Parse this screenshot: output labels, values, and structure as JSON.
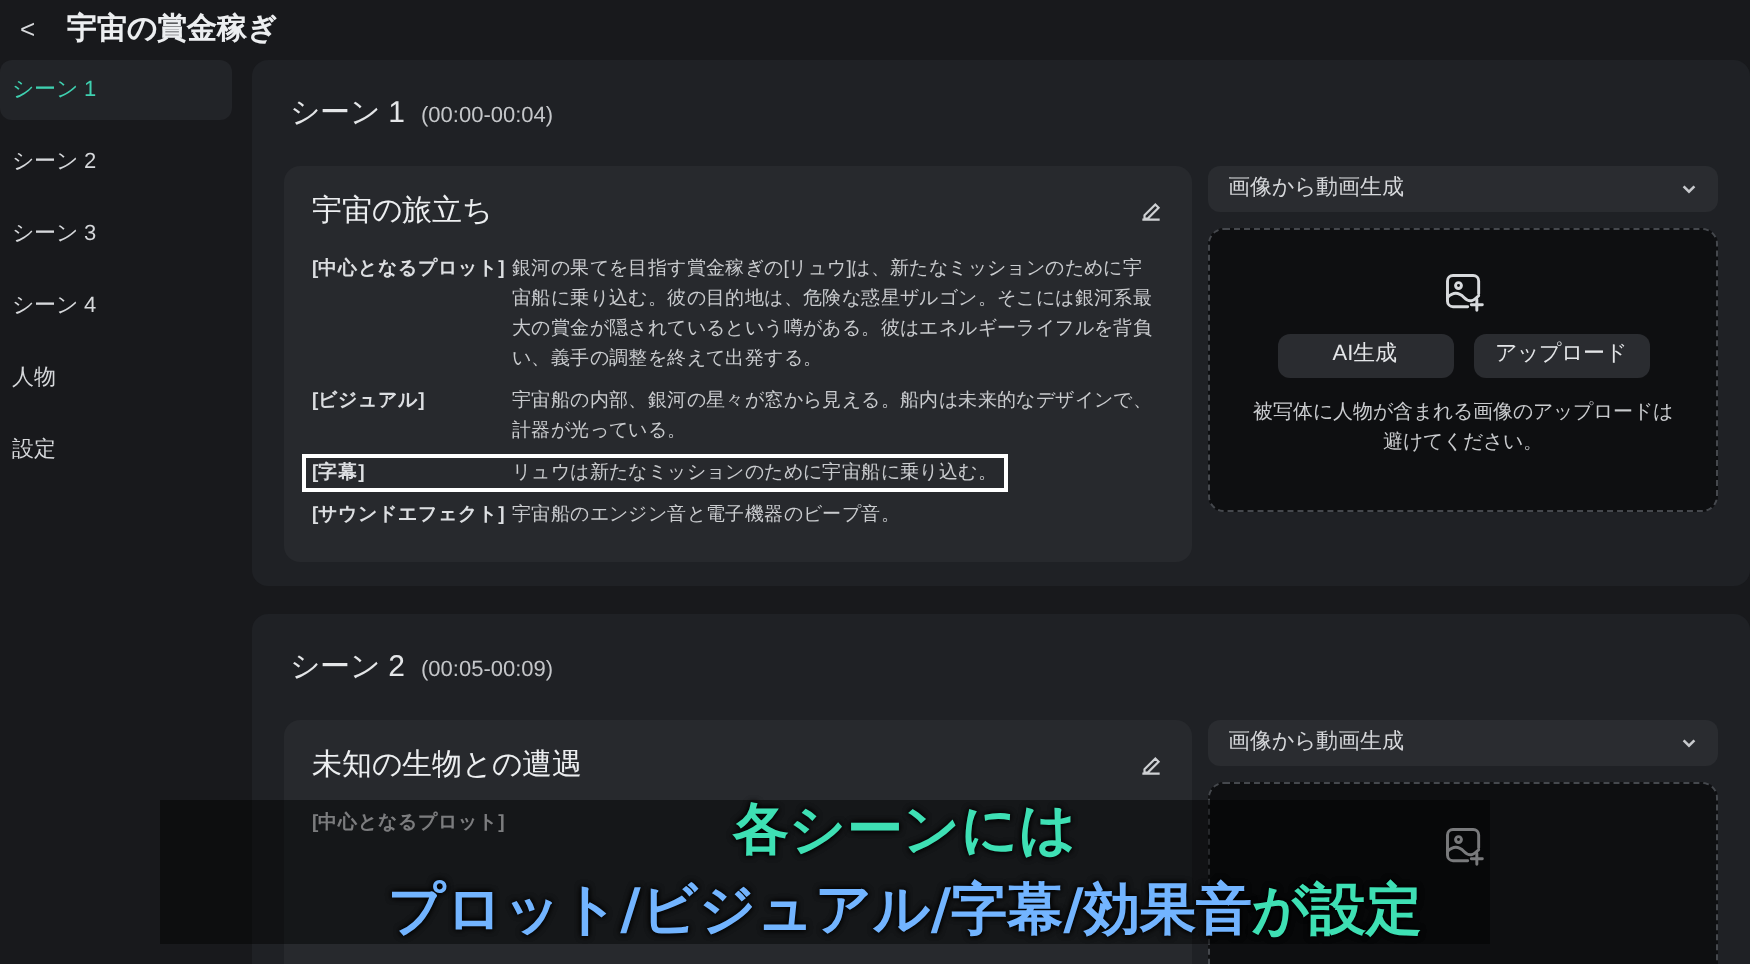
{
  "header": {
    "back": "<",
    "title": "宇宙の賞金稼ぎ"
  },
  "sidebar": {
    "items": [
      {
        "label": "シーン 1",
        "selected": true
      },
      {
        "label": "シーン 2",
        "selected": false
      },
      {
        "label": "シーン 3",
        "selected": false
      },
      {
        "label": "シーン 4",
        "selected": false
      },
      {
        "label": "人物",
        "selected": false
      },
      {
        "label": "設定",
        "selected": false
      }
    ]
  },
  "scenes": [
    {
      "name": "シーン 1",
      "time": "(00:00-00:04)",
      "title": "宇宙の旅立ち",
      "rows": [
        {
          "label": "[中心となるプロット]",
          "text": "銀河の果てを目指す賞金稼ぎの[リュウ]は、新たなミッションのために宇宙船に乗り込む。彼の目的地は、危険な惑星ザルゴン。そこには銀河系最大の賞金が隠されているという噂がある。彼はエネルギーライフルを背負い、義手の調整を終えて出発する。",
          "highlighted": false
        },
        {
          "label": "[ビジュアル]",
          "text": "宇宙船の内部、銀河の星々が窓から見える。船内は未来的なデザインで、計器が光っている。",
          "highlighted": false
        },
        {
          "label": "[字幕]",
          "text": "リュウは新たなミッションのために宇宙船に乗り込む。",
          "highlighted": true
        },
        {
          "label": "[サウンドエフェクト]",
          "text": "宇宙船のエンジン音と電子機器のビープ音。",
          "highlighted": false
        }
      ],
      "media": {
        "mode": "画像から動画生成",
        "buttons": [
          "AI生成",
          "アップロード"
        ],
        "note": "被写体に人物が含まれる画像のアップロードは避けてください。"
      }
    },
    {
      "name": "シーン 2",
      "time": "(00:05-00:09)",
      "title": "未知の生物との遭遇",
      "rows": [
        {
          "label": "[中心となるプロット]",
          "highlighted": false
        }
      ],
      "media": {
        "mode": "画像から動画生成"
      }
    }
  ],
  "caption": {
    "lines": [
      [
        {
          "text": "各シーンには",
          "color": "#3ee0b4"
        }
      ],
      [
        {
          "text": "プロット/ビジュアル/字幕/効果音",
          "color": "#72b4ff"
        },
        {
          "text": "が設定",
          "color": "#3ee0b4"
        }
      ]
    ]
  }
}
